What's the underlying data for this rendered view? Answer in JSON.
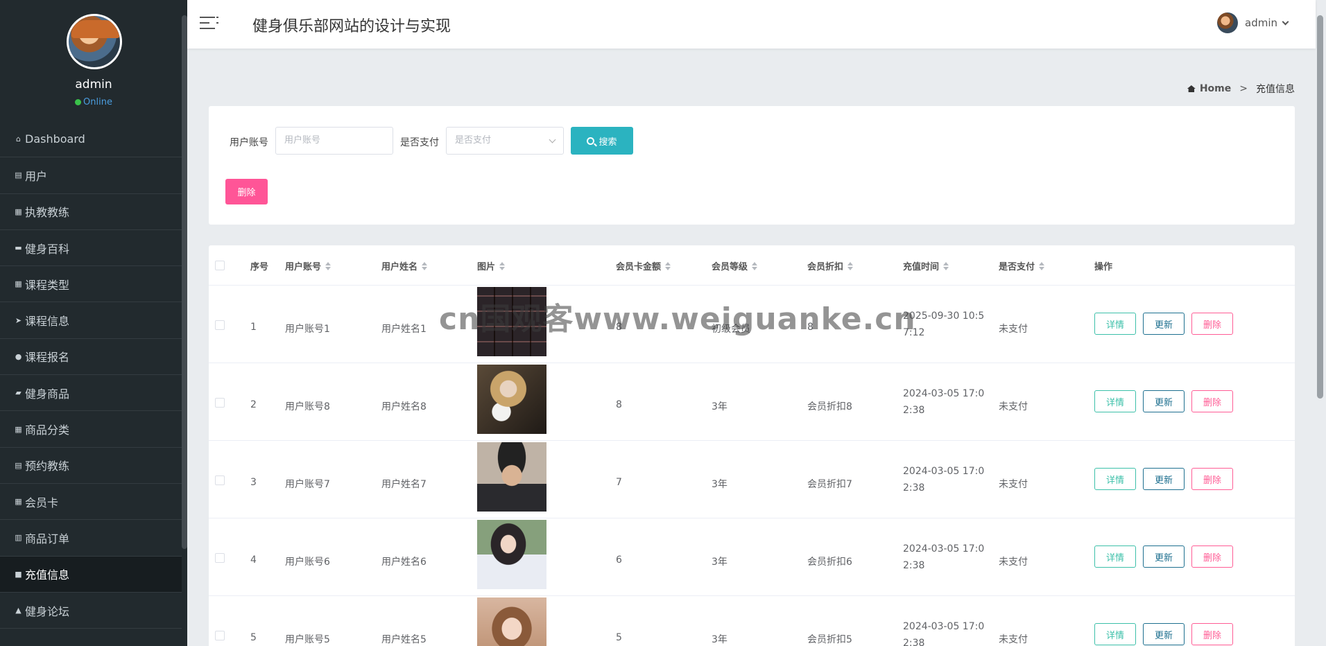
{
  "sidebar": {
    "user": {
      "name": "admin",
      "status": "Online"
    },
    "items": [
      {
        "label": "Dashboard",
        "icon": "home-icon",
        "glyph": "⌂"
      },
      {
        "label": "用户",
        "icon": "clipboard-icon",
        "glyph": "▤"
      },
      {
        "label": "执教教练",
        "icon": "grid-icon",
        "glyph": "▦"
      },
      {
        "label": "健身百科",
        "icon": "briefcase-icon",
        "glyph": "▬"
      },
      {
        "label": "课程类型",
        "icon": "grid-icon",
        "glyph": "▦"
      },
      {
        "label": "课程信息",
        "icon": "paper-plane-icon",
        "glyph": "➤"
      },
      {
        "label": "课程报名",
        "icon": "map-pin-icon",
        "glyph": "●"
      },
      {
        "label": "健身商品",
        "icon": "video-icon",
        "glyph": "▰"
      },
      {
        "label": "商品分类",
        "icon": "grid-icon",
        "glyph": "▦"
      },
      {
        "label": "预约教练",
        "icon": "file-icon",
        "glyph": "▤"
      },
      {
        "label": "会员卡",
        "icon": "table-icon",
        "glyph": "▦"
      },
      {
        "label": "商品订单",
        "icon": "bar-chart-icon",
        "glyph": "▥"
      },
      {
        "label": "充值信息",
        "icon": "comment-icon",
        "glyph": "■"
      },
      {
        "label": "健身论坛",
        "icon": "user-icon",
        "glyph": "▲"
      }
    ],
    "active_index": 12
  },
  "header": {
    "title": "健身俱乐部网站的设计与实现",
    "user": "admin"
  },
  "breadcrumb": {
    "home": "Home",
    "separator": ">",
    "current": "充值信息"
  },
  "search": {
    "account_label": "用户账号",
    "account_placeholder": "用户账号",
    "paid_label": "是否支付",
    "paid_placeholder": "是否支付",
    "search_button": "搜索",
    "delete_button": "删除"
  },
  "table": {
    "columns": [
      "序号",
      "用户账号",
      "用户姓名",
      "图片",
      "会员卡金额",
      "会员等级",
      "会员折扣",
      "充值时间",
      "是否支付",
      "操作"
    ],
    "rows": [
      {
        "index": "1",
        "account": "用户账号1",
        "name": "用户姓名1",
        "amount": "8",
        "level": "初级会员",
        "discount": "8",
        "time": "2025-09-30 10:57:12",
        "paid": "未支付",
        "image": "collage-photo"
      },
      {
        "index": "2",
        "account": "用户账号8",
        "name": "用户姓名8",
        "amount": "8",
        "level": "3年",
        "discount": "会员折扣8",
        "time": "2024-03-05 17:02:38",
        "paid": "未支付",
        "image": "girl-with-cat-photo"
      },
      {
        "index": "3",
        "account": "用户账号7",
        "name": "用户姓名7",
        "amount": "7",
        "level": "3年",
        "discount": "会员折扣7",
        "time": "2024-03-05 17:02:38",
        "paid": "未支付",
        "image": "young-man-photo"
      },
      {
        "index": "4",
        "account": "用户账号6",
        "name": "用户姓名6",
        "amount": "6",
        "level": "3年",
        "discount": "会员折扣6",
        "time": "2024-03-05 17:02:38",
        "paid": "未支付",
        "image": "girl-white-shirt-photo"
      },
      {
        "index": "5",
        "account": "用户账号5",
        "name": "用户姓名5",
        "amount": "5",
        "level": "3年",
        "discount": "会员折扣5",
        "time": "2024-03-05 17:02:38",
        "paid": "未支付",
        "image": "girl-portrait-photo"
      }
    ],
    "actions": {
      "detail": "详情",
      "update": "更新",
      "delete": "删除"
    }
  },
  "watermark": "cn国观客www.weiguanke.cn",
  "colors": {
    "sidebar_bg": "#222a2e",
    "accent": "#2bb3c0",
    "danger": "#ff5597",
    "detail": "#3cc0a9",
    "update": "#1d6f8f"
  }
}
